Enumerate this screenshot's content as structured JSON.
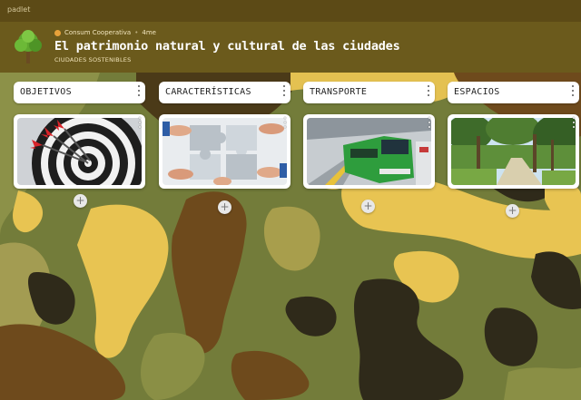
{
  "app": {
    "brand": "padlet"
  },
  "header": {
    "author": "Consum Cooperativa",
    "separator": "•",
    "time": "4me",
    "title": "El patrimonio natural y cultural de las ciudades",
    "subtitle": "CIUDADES SOSTENIBLES"
  },
  "columns": [
    {
      "label": "OBJETIVOS",
      "image": "dartboard-with-darts"
    },
    {
      "label": "CARACTERÍSTICAS",
      "image": "hands-holding-puzzle-pieces"
    },
    {
      "label": "TRANSPORTE",
      "image": "green-train-at-station"
    },
    {
      "label": "ESPACIOS",
      "image": "tree-lined-park-path"
    }
  ],
  "add_label": "+",
  "colors": {
    "background": "#6f7a36",
    "header": "#6b5a1c",
    "camo_dark": "#2f2a1a",
    "camo_brown": "#6e4a1c",
    "camo_yellow": "#e8c452",
    "camo_olive": "#8a8f45"
  }
}
